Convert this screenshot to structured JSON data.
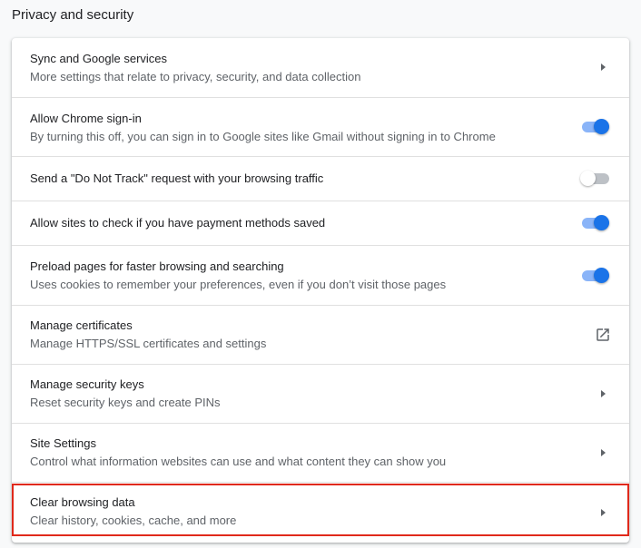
{
  "section": {
    "title": "Privacy and security"
  },
  "rows": [
    {
      "primary": "Sync and Google services",
      "secondary": "More settings that relate to privacy, security, and data collection",
      "control": "arrow"
    },
    {
      "primary": "Allow Chrome sign-in",
      "secondary": "By turning this off, you can sign in to Google sites like Gmail without signing in to Chrome",
      "control": "toggle",
      "checked": true
    },
    {
      "primary": "Send a \"Do Not Track\" request with your browsing traffic",
      "control": "toggle",
      "checked": false
    },
    {
      "primary": "Allow sites to check if you have payment methods saved",
      "control": "toggle",
      "checked": true
    },
    {
      "primary": "Preload pages for faster browsing and searching",
      "secondary": "Uses cookies to remember your preferences, even if you don’t visit those pages",
      "control": "toggle",
      "checked": true
    },
    {
      "primary": "Manage certificates",
      "secondary": "Manage HTTPS/SSL certificates and settings",
      "control": "external-link"
    },
    {
      "primary": "Manage security keys",
      "secondary": "Reset security keys and create PINs",
      "control": "arrow"
    },
    {
      "primary": "Site Settings",
      "secondary": "Control what information websites can use and what content they can show you",
      "control": "arrow"
    },
    {
      "primary": "Clear browsing data",
      "secondary": "Clear history, cookies, cache, and more",
      "control": "arrow",
      "highlighted": true
    }
  ],
  "colors": {
    "accent": "#1a73e8",
    "accent_track": "#8ab4f8",
    "highlight_border": "#e0291b"
  }
}
